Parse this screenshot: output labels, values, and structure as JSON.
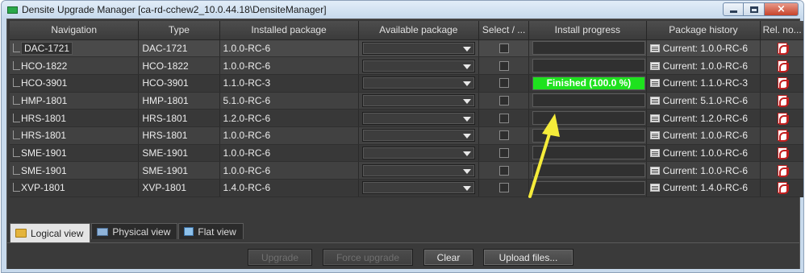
{
  "window": {
    "title": "Densite Upgrade Manager [ca-rd-cchew2_10.0.44.18\\DensiteManager]",
    "close_glyph": "×"
  },
  "table": {
    "headers": {
      "navigation": "Navigation",
      "type": "Type",
      "installed": "Installed package",
      "available": "Available package",
      "select": "Select / ...",
      "progress": "Install progress",
      "history": "Package history",
      "relnotes": "Rel. no..."
    },
    "rows": [
      {
        "nav": "DAC-1721",
        "type": "DAC-1721",
        "installed": "1.0.0-RC-6",
        "history": "Current: 1.0.0-RC-6"
      },
      {
        "nav": "HCO-1822",
        "type": "HCO-1822",
        "installed": "1.0.0-RC-6",
        "history": "Current: 1.0.0-RC-6"
      },
      {
        "nav": "HCO-3901",
        "type": "HCO-3901",
        "installed": "1.1.0-RC-3",
        "history": "Current: 1.1.0-RC-3",
        "progress_text": "Finished (100.0 %)",
        "progress_fraction": 1.0
      },
      {
        "nav": "HMP-1801",
        "type": "HMP-1801",
        "installed": "5.1.0-RC-6",
        "history": "Current: 5.1.0-RC-6"
      },
      {
        "nav": "HRS-1801",
        "type": "HRS-1801",
        "installed": "1.2.0-RC-6",
        "history": "Current: 1.2.0-RC-6"
      },
      {
        "nav": "HRS-1801",
        "type": "HRS-1801",
        "installed": "1.0.0-RC-6",
        "history": "Current: 1.0.0-RC-6"
      },
      {
        "nav": "SME-1901",
        "type": "SME-1901",
        "installed": "1.0.0-RC-6",
        "history": "Current: 1.0.0-RC-6"
      },
      {
        "nav": "SME-1901",
        "type": "SME-1901",
        "installed": "1.0.0-RC-6",
        "history": "Current: 1.0.0-RC-6"
      },
      {
        "nav": "XVP-1801",
        "type": "XVP-1801",
        "installed": "1.4.0-RC-6",
        "history": "Current: 1.4.0-RC-6"
      }
    ]
  },
  "tabs": [
    {
      "label": "Logical view",
      "icon": "folder-icon",
      "active": true
    },
    {
      "label": "Physical view",
      "icon": "monitor-icon",
      "active": false
    },
    {
      "label": "Flat view",
      "icon": "list-icon",
      "active": false
    }
  ],
  "buttons": {
    "upgrade": "Upgrade",
    "force_upgrade": "Force upgrade",
    "clear": "Clear",
    "upload": "Upload files..."
  },
  "colors": {
    "progress_fill": "#1ee21e",
    "annotation_arrow": "#f5ec3a"
  }
}
